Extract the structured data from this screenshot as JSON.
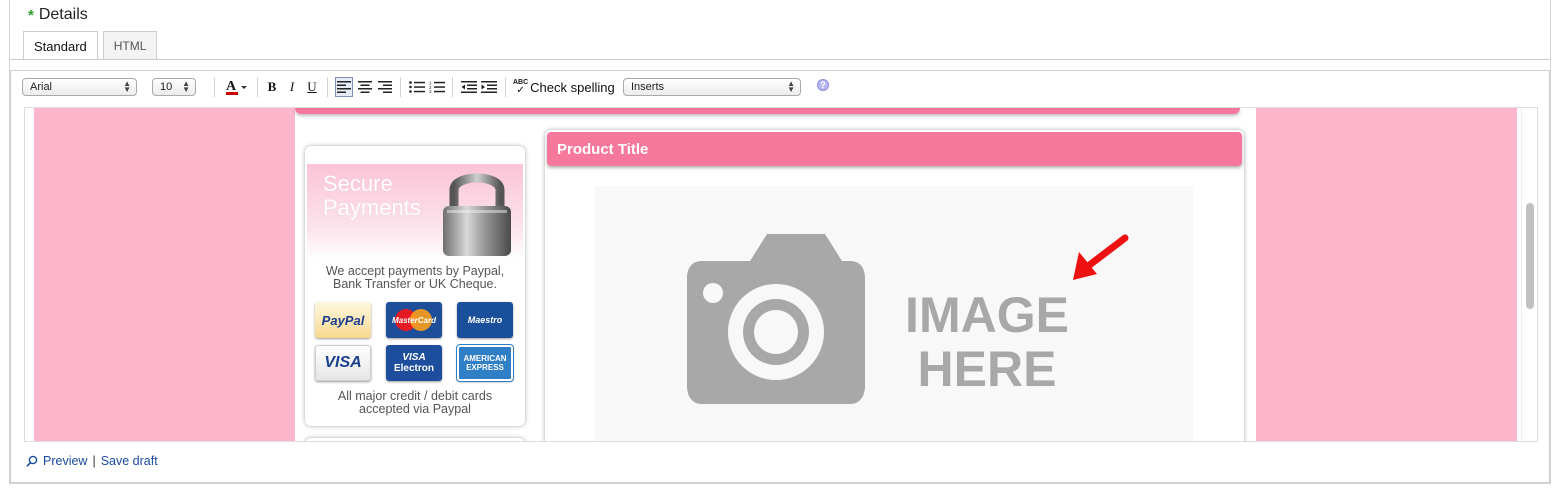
{
  "section": {
    "title": "Details",
    "required_marker": "*"
  },
  "tabs": [
    {
      "label": "Standard",
      "active": true
    },
    {
      "label": "HTML",
      "active": false
    }
  ],
  "toolbar": {
    "font_family": "Arial",
    "font_size": "10",
    "bold": "B",
    "italic": "I",
    "underline": "U",
    "spell_label": "Check spelling",
    "spell_icon_text": "ABC",
    "inserts": "Inserts",
    "help": "?"
  },
  "template": {
    "secure_line1": "Secure",
    "secure_line2": "Payments",
    "pay_line1": "We accept payments by Paypal,",
    "pay_line2": "Bank Transfer or UK Cheque.",
    "cards": {
      "paypal": "PayPal",
      "mastercard": "MasterCard",
      "maestro": "Maestro",
      "visa": "VISA",
      "visa_electron_1": "VISA",
      "visa_electron_2": "Electron",
      "amex_1": "AMERICAN",
      "amex_2": "EXPRESS"
    },
    "all_cards_1": "All major credit / debit cards",
    "all_cards_2": "accepted via Paypal",
    "product_title": "Product Title",
    "image_line1": "IMAGE",
    "image_line2": "HERE"
  },
  "footer": {
    "preview": "Preview",
    "separator": "|",
    "save_draft": "Save draft"
  },
  "colors": {
    "pink_side": "#fbb6cb",
    "pink_bar": "#f7789d",
    "placeholder_grey": "#a8a8a8",
    "arrow_red": "#ee1111",
    "link_blue": "#1a4a9c"
  }
}
